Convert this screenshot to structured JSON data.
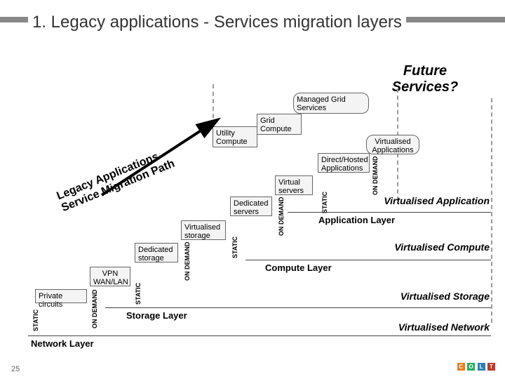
{
  "title": "1. Legacy applications - Services migration layers",
  "future": "Future Services?",
  "stairs": {
    "utility": "Utility Compute",
    "grid": "Grid Compute",
    "managed": "Managed Grid Services",
    "virtapps": "Virtualised Applications",
    "direct": "Direct/Hosted Applications",
    "virtservers": "Virtual servers",
    "dedservers": "Dedicated servers",
    "virtstorage": "Virtualised storage",
    "dedstorage": "Dedicated storage",
    "vpn": "VPN WAN/LAN",
    "private": "Private circuits"
  },
  "layers": {
    "app": "Application Layer",
    "compute": "Compute Layer",
    "storage": "Storage Layer",
    "network": "Network Layer"
  },
  "vlabels": {
    "vapp": "Virtualised Application",
    "vcompute": "Virtualised Compute",
    "vstorage": "Virtualised Storage",
    "vnetwork": "Virtualised Network"
  },
  "axis": {
    "static": "STATIC",
    "ondemand": "ON DEMAND"
  },
  "diag": {
    "line1": "Legacy Applications",
    "line2": "Service Migration Path"
  },
  "page": "25",
  "logo": {
    "c": "C",
    "o": "O",
    "l": "L",
    "t": "T"
  }
}
